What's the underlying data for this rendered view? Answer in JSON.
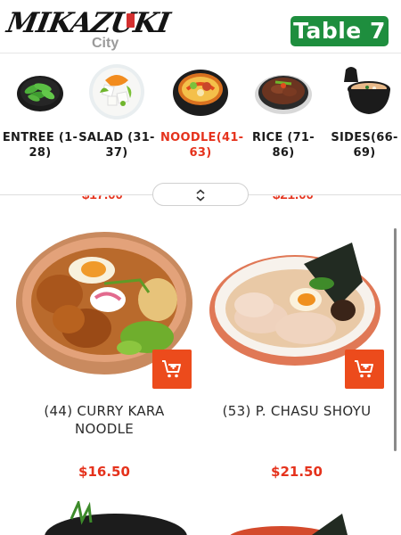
{
  "header": {
    "logo_text": "MIKAZUKI",
    "logo_sub": "City",
    "table_label": "Table 7"
  },
  "categories": [
    {
      "label": "ENTREE (1-28)",
      "icon": "edamame-dish-icon",
      "active": false
    },
    {
      "label": "SALAD (31-37)",
      "icon": "salad-dish-icon",
      "active": false
    },
    {
      "label": "NOODLE(41-63)",
      "icon": "noodle-bowl-icon",
      "active": true
    },
    {
      "label": "RICE (71-86)",
      "icon": "rice-bowl-icon",
      "active": false
    },
    {
      "label": "SIDES(66-69)",
      "icon": "miso-soup-icon",
      "active": false
    }
  ],
  "items": [
    {
      "name": "(44) CURRY KARA NOODLE",
      "price": "$16.50",
      "image": "curry-kara-noodle-photo"
    },
    {
      "name": "(53) P. CHASU SHOYU",
      "price": "$21.50",
      "image": "chasu-shoyu-ramen-photo"
    }
  ],
  "colors": {
    "accent": "#e5321c",
    "cart": "#ec4b1c",
    "table_badge": "#1e8e3e"
  }
}
